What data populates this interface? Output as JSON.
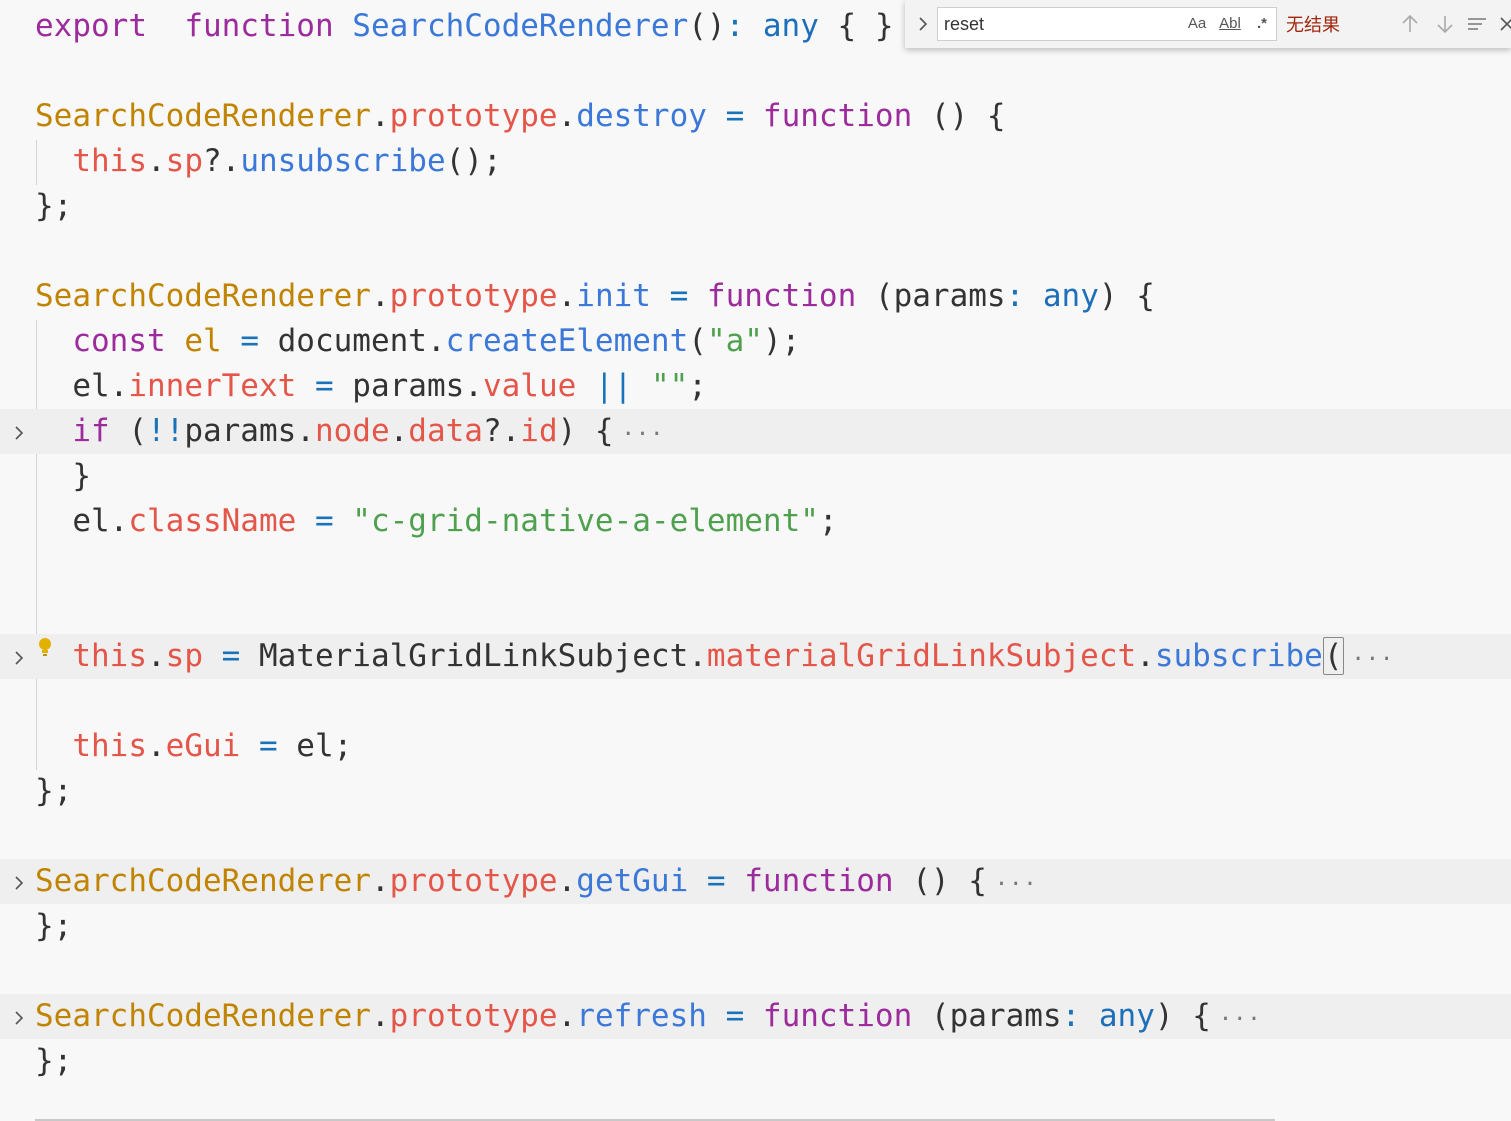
{
  "find_widget": {
    "query": "reset",
    "match_case_label": "Aa",
    "whole_word_label": "Abl",
    "regex_label": ".*",
    "status": "无结果",
    "toggle_icon": "chevron-right-icon",
    "prev_icon": "arrow-up-icon",
    "next_icon": "arrow-down-icon",
    "selection_icon": "find-in-selection-icon",
    "close_icon": "close-icon"
  },
  "ellipsis": "···",
  "colors": {
    "keyword": "#9c2b9c",
    "function": "#3b78d8",
    "class": "#c18401",
    "property": "#e45649",
    "string": "#50a14f",
    "type": "#1c6fb8",
    "find_status": "#a1260d"
  },
  "lines": [
    {
      "tokens": [
        [
          "kw",
          "export"
        ],
        [
          "",
          "  "
        ],
        [
          "kw",
          "function"
        ],
        [
          "",
          ""
        ],
        [
          "fn",
          " SearchCodeRenderer"
        ],
        [
          "",
          "()"
        ],
        [
          "op",
          ":"
        ],
        [
          "typ",
          " any"
        ],
        [
          "",
          " { }"
        ]
      ]
    },
    {
      "tokens": [
        [
          "cls",
          "SearchCodeRenderer"
        ],
        [
          "",
          "."
        ],
        [
          "prop",
          "prototype"
        ],
        [
          "",
          "."
        ],
        [
          "fn",
          "destroy"
        ],
        [
          "op",
          " ="
        ],
        [
          "kw",
          " function"
        ],
        [
          "",
          " () {"
        ]
      ]
    },
    {
      "tokens": [
        [
          "thisv",
          "  this"
        ],
        [
          "",
          "."
        ],
        [
          "prop",
          "sp"
        ],
        [
          "",
          "?."
        ],
        [
          "fn",
          "unsubscribe"
        ],
        [
          "",
          "();"
        ]
      ]
    },
    {
      "tokens": [
        [
          "",
          "};"
        ]
      ]
    },
    {
      "tokens": [
        [
          "cls",
          "SearchCodeRenderer"
        ],
        [
          "",
          "."
        ],
        [
          "prop",
          "prototype"
        ],
        [
          "",
          "."
        ],
        [
          "fn",
          "init"
        ],
        [
          "op",
          " ="
        ],
        [
          "kw",
          " function"
        ],
        [
          "",
          " (params"
        ],
        [
          "op",
          ":"
        ],
        [
          "typ",
          " any"
        ],
        [
          "",
          ") {"
        ]
      ]
    },
    {
      "tokens": [
        [
          "kw",
          "  const"
        ],
        [
          "cls",
          " el"
        ],
        [
          "op",
          " ="
        ],
        [
          "",
          " document."
        ],
        [
          "fn",
          "createElement"
        ],
        [
          "",
          "("
        ],
        [
          "str",
          "\"a\""
        ],
        [
          "",
          ");"
        ]
      ]
    },
    {
      "tokens": [
        [
          "",
          "  el."
        ],
        [
          "prop",
          "innerText"
        ],
        [
          "op",
          " ="
        ],
        [
          "",
          " params."
        ],
        [
          "prop",
          "value"
        ],
        [
          "op",
          " ||"
        ],
        [
          "str",
          " \"\""
        ],
        [
          "",
          ";"
        ]
      ]
    },
    {
      "tokens": [
        [
          "kw",
          "  if"
        ],
        [
          "",
          " ("
        ],
        [
          "op",
          "!!"
        ],
        [
          "",
          "params."
        ],
        [
          "prop",
          "node"
        ],
        [
          "",
          "."
        ],
        [
          "prop",
          "data"
        ],
        [
          "",
          "?."
        ],
        [
          "prop",
          "id"
        ],
        [
          "",
          ") {"
        ]
      ]
    },
    {
      "tokens": [
        [
          "",
          "  }"
        ]
      ]
    },
    {
      "tokens": [
        [
          "",
          "  el."
        ],
        [
          "prop",
          "className"
        ],
        [
          "op",
          " ="
        ],
        [
          "str",
          " \"c-grid-native-a-element\""
        ],
        [
          "",
          ";"
        ]
      ]
    },
    {
      "tokens": [
        [
          "thisv",
          "  this"
        ],
        [
          "",
          "."
        ],
        [
          "prop",
          "sp"
        ],
        [
          "op",
          " ="
        ],
        [
          "",
          " MaterialGridLinkSubject."
        ],
        [
          "prop",
          "materialGridLinkSubject"
        ],
        [
          "",
          "."
        ],
        [
          "fn",
          "subscribe"
        ]
      ]
    },
    {
      "tokens": [
        [
          "thisv",
          "  this"
        ],
        [
          "",
          "."
        ],
        [
          "prop",
          "eGui"
        ],
        [
          "op",
          " ="
        ],
        [
          "",
          " el;"
        ]
      ]
    },
    {
      "tokens": [
        [
          "",
          "};"
        ]
      ]
    },
    {
      "tokens": [
        [
          "cls",
          "SearchCodeRenderer"
        ],
        [
          "",
          "."
        ],
        [
          "prop",
          "prototype"
        ],
        [
          "",
          "."
        ],
        [
          "fn",
          "getGui"
        ],
        [
          "op",
          " ="
        ],
        [
          "kw",
          " function"
        ],
        [
          "",
          " () {"
        ]
      ]
    },
    {
      "tokens": [
        [
          "",
          "};"
        ]
      ]
    },
    {
      "tokens": [
        [
          "cls",
          "SearchCodeRenderer"
        ],
        [
          "",
          "."
        ],
        [
          "prop",
          "prototype"
        ],
        [
          "",
          "."
        ],
        [
          "fn",
          "refresh"
        ],
        [
          "op",
          " ="
        ],
        [
          "kw",
          " function"
        ],
        [
          "",
          " (params"
        ],
        [
          "op",
          ":"
        ],
        [
          "typ",
          " any"
        ],
        [
          "",
          ") {"
        ]
      ]
    },
    {
      "tokens": [
        [
          "",
          "};"
        ]
      ]
    }
  ]
}
